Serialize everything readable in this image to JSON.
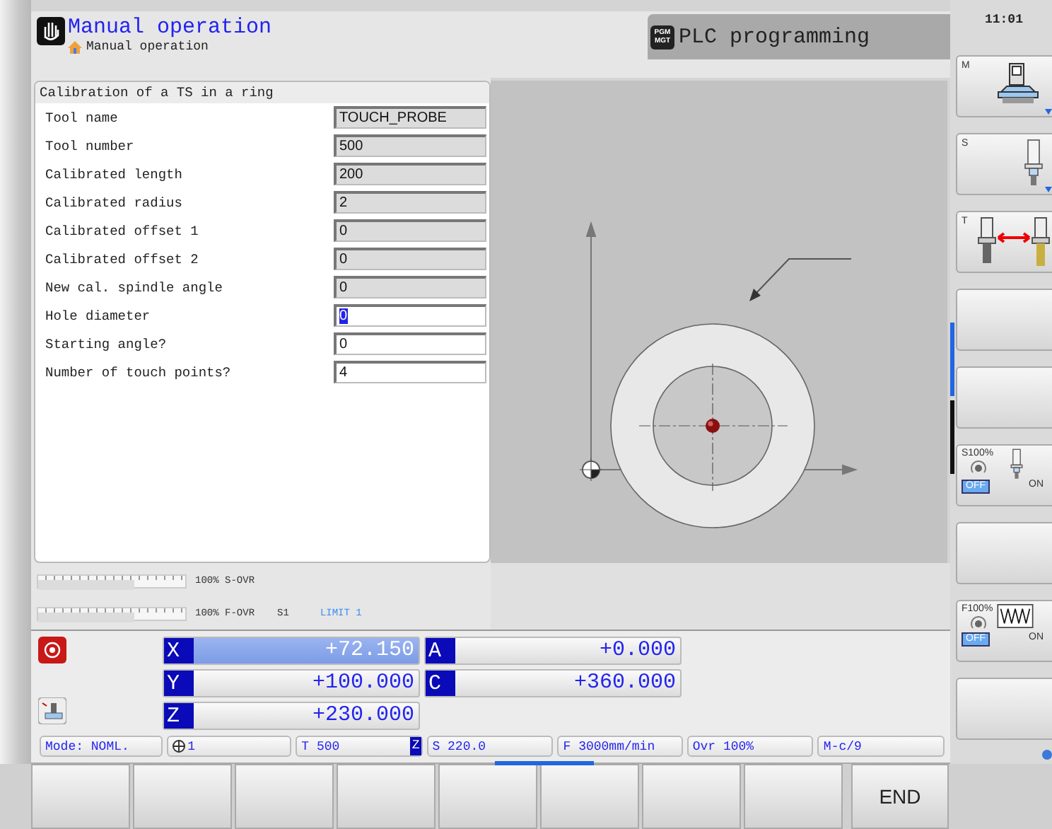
{
  "header": {
    "title": "Manual operation",
    "subtitle": "Manual operation",
    "secondary_mode": {
      "badge_lines": [
        "PGM",
        "MGT"
      ],
      "label": "PLC programming"
    }
  },
  "form": {
    "title": "Calibration of a TS in a ring",
    "fields": [
      {
        "label": "Tool name",
        "value": "TOUCH_PROBE",
        "editable": false,
        "focused": false
      },
      {
        "label": "Tool number",
        "value": "500",
        "editable": false,
        "focused": false
      },
      {
        "label": "Calibrated length",
        "value": "200",
        "editable": false,
        "focused": false
      },
      {
        "label": "Calibrated radius",
        "value": "2",
        "editable": false,
        "focused": false
      },
      {
        "label": "Calibrated offset 1",
        "value": "0",
        "editable": false,
        "focused": false
      },
      {
        "label": "Calibrated offset 2",
        "value": "0",
        "editable": false,
        "focused": false
      },
      {
        "label": "New cal. spindle angle",
        "value": "0",
        "editable": false,
        "focused": false
      },
      {
        "label": "Hole diameter",
        "value": "0",
        "editable": true,
        "focused": true
      },
      {
        "label": "Starting angle?",
        "value": "0",
        "editable": true,
        "focused": false
      },
      {
        "label": "Number of touch points?",
        "value": "4",
        "editable": true,
        "focused": false
      }
    ]
  },
  "overrides": [
    {
      "reading": "100%",
      "label": "S-OVR",
      "level": 0.65
    },
    {
      "reading": "100%",
      "label": "F-OVR",
      "level": 0.65,
      "tags": [
        {
          "kind": "plain",
          "text": "S1"
        },
        {
          "kind": "limit",
          "text": "LIMIT 1"
        }
      ]
    }
  ],
  "positions": {
    "linear": [
      {
        "axis": "X",
        "value": "+72.150",
        "selected": true
      },
      {
        "axis": "Y",
        "value": "+100.000",
        "selected": false
      },
      {
        "axis": "Z",
        "value": "+230.000",
        "selected": false
      }
    ],
    "rotary": [
      {
        "axis": "A",
        "value": "+0.000",
        "selected": false
      },
      {
        "axis": "C",
        "value": "+360.000",
        "selected": false
      }
    ]
  },
  "status_bar": [
    {
      "kind": "text",
      "text": "Mode: NOML."
    },
    {
      "kind": "datum",
      "text": "1"
    },
    {
      "kind": "tool",
      "text": "T 500",
      "badge": "Z"
    },
    {
      "kind": "text",
      "text": "S 220.0"
    },
    {
      "kind": "text",
      "text": "F 3000mm/min"
    },
    {
      "kind": "text",
      "text": "Ovr 100%"
    },
    {
      "kind": "text",
      "text": "M-c/9"
    }
  ],
  "clock": "11:01",
  "side_softkeys": [
    {
      "kind": "machine",
      "label": "M"
    },
    {
      "kind": "spindle",
      "label": "S"
    },
    {
      "kind": "tool_change",
      "label": "T"
    },
    {
      "kind": "blank"
    },
    {
      "kind": "blank"
    },
    {
      "kind": "spindle_override",
      "label": "S100%",
      "options": [
        {
          "text": "OFF",
          "selected": true
        },
        {
          "text": "ON",
          "selected": false
        }
      ]
    },
    {
      "kind": "blank"
    },
    {
      "kind": "feed_override",
      "label": "F100%",
      "options": [
        {
          "text": "OFF",
          "selected": true
        },
        {
          "text": "ON",
          "selected": false
        }
      ]
    },
    {
      "kind": "blank"
    }
  ],
  "softkeys": [
    {
      "kind": "blank"
    },
    {
      "kind": "blank"
    },
    {
      "kind": "blank"
    },
    {
      "kind": "blank"
    },
    {
      "kind": "blank"
    },
    {
      "kind": "blank"
    },
    {
      "kind": "blank"
    },
    {
      "kind": "blank"
    },
    {
      "kind": "text",
      "label": "END"
    }
  ]
}
